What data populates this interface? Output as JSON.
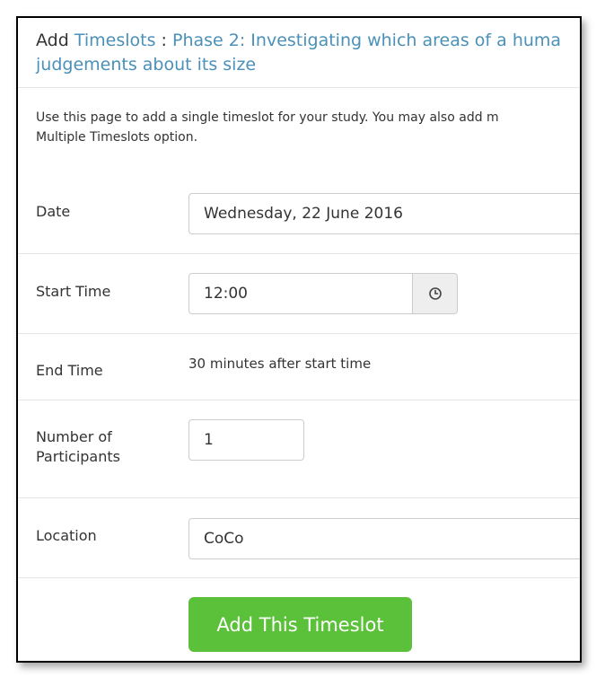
{
  "header": {
    "prefix": "Add",
    "link": "Timeslots",
    "separator": ":",
    "study_line1": "Phase 2: Investigating which areas of a huma",
    "study_line2": "judgements about its size"
  },
  "intro": {
    "line1": "Use this page to add a single timeslot for your study. You may also add m",
    "line2": "Multiple Timeslots option."
  },
  "form": {
    "date": {
      "label": "Date",
      "value": "Wednesday, 22 June 2016"
    },
    "start_time": {
      "label": "Start Time",
      "value": "12:00",
      "icon": "clock-icon"
    },
    "end_time": {
      "label": "End Time",
      "value": "30 minutes after start time"
    },
    "participants": {
      "label_line1": "Number of",
      "label_line2": "Participants",
      "value": "1"
    },
    "location": {
      "label": "Location",
      "value": "CoCo"
    }
  },
  "submit": {
    "label": "Add This Timeslot"
  },
  "colors": {
    "link": "#4a90b8",
    "button": "#5cc13a",
    "text": "#333333"
  }
}
